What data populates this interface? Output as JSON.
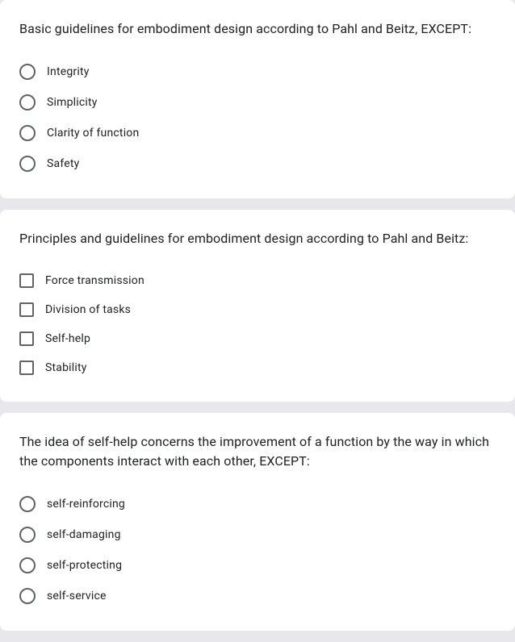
{
  "questions": [
    {
      "text": "Basic guidelines for embodiment design according to Pahl and Beitz, EXCEPT:",
      "type": "radio",
      "options": [
        "Integrity",
        "Simplicity",
        "Clarity of function",
        "Safety"
      ]
    },
    {
      "text": "Principles and guidelines for embodiment design according to Pahl and Beitz:",
      "type": "checkbox",
      "options": [
        "Force transmission",
        "Division of tasks",
        "Self-help",
        "Stability"
      ]
    },
    {
      "text": "The idea of self-help concerns the improvement of a function by the way in which the components interact with each other, EXCEPT:",
      "type": "radio",
      "options": [
        "self-reinforcing",
        "self-damaging",
        "self-protecting",
        "self-service"
      ]
    }
  ]
}
